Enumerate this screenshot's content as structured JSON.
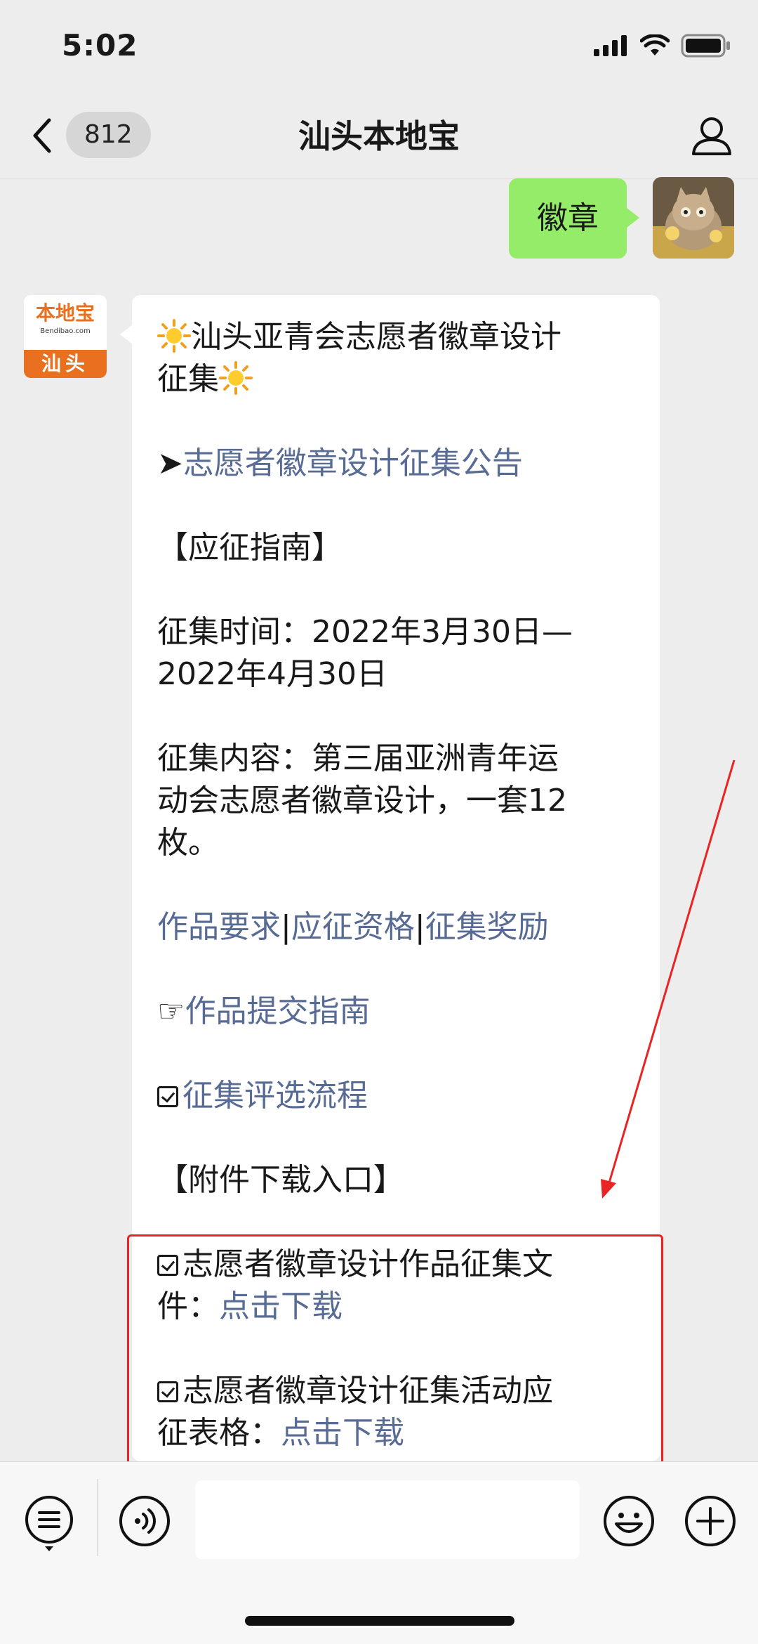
{
  "status": {
    "time": "5:02"
  },
  "nav": {
    "back_count": "812",
    "title": "汕头本地宝"
  },
  "sent": {
    "text": "徽章"
  },
  "avatar": {
    "logo_text": "本地宝",
    "logo_url": "Bendibao.com",
    "logo_city": "汕头"
  },
  "message": {
    "title_line1": "汕头亚青会志愿者徽章设计",
    "title_line2": "征集",
    "arrow_symbol": "➤",
    "announcement_link": "志愿者徽章设计征集公告",
    "guide_heading": "【应征指南】",
    "time_line1": "征集时间：2022年3月30日—",
    "time_line2": "2022年4月30日",
    "content_line1": "征集内容：第三届亚洲青年运",
    "content_line2": "动会志愿者徽章设计，一套12",
    "content_line3": "枚。",
    "link_requirements": "作品要求",
    "link_separator": "|",
    "link_eligibility": "应征资格",
    "link_rewards": "征集奖励",
    "hand_symbol": "☞",
    "link_submit": "作品提交指南",
    "link_process": "征集评选流程",
    "download_heading": "【附件下载入口】",
    "file1_line1": "志愿者徽章设计作品征集文",
    "file1_line2": "件：",
    "file2_line1": "志愿者徽章设计征集活动应",
    "file2_line2": "征表格：",
    "download_link": "点击下载"
  },
  "colors": {
    "sent_bubble": "#95ec69",
    "link": "#576b95",
    "annotation": "#e82424",
    "brand": "#e8701e"
  }
}
